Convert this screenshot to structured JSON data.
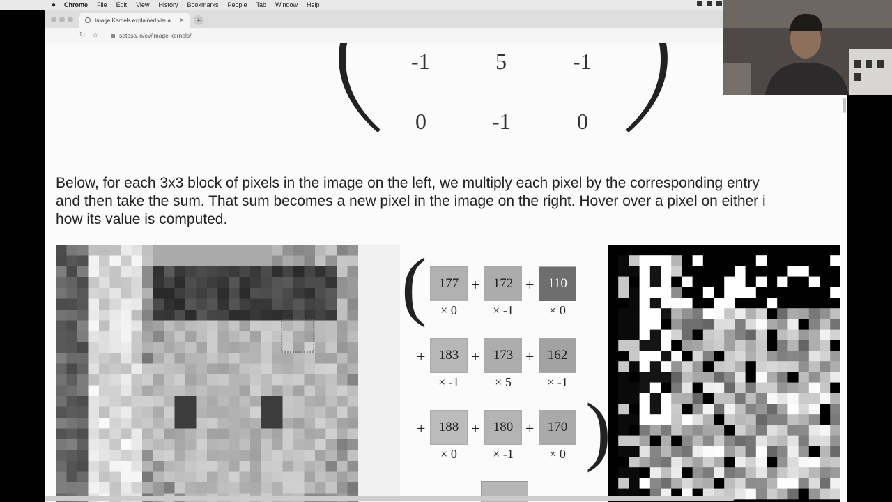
{
  "menubar": {
    "app": "Chrome",
    "items": [
      "File",
      "Edit",
      "View",
      "History",
      "Bookmarks",
      "People",
      "Tab",
      "Window",
      "Help"
    ]
  },
  "browser": {
    "tab_title": "Image Kernels explained visua",
    "new_tab": "+",
    "tab_close": "×",
    "url": "setosa.io/ev/image-kernels/"
  },
  "kernel_matrix": {
    "row2": [
      "-1",
      "5",
      "-1"
    ],
    "row3": [
      "0",
      "-1",
      "0"
    ]
  },
  "paragraph": {
    "line1": "Below, for each 3x3 block of pixels in the image on the left, we multiply each pixel by the corresponding entry",
    "line2": "and then take the sum. That sum becomes a new pixel in the image on the right. Hover over a pixel on either i",
    "line3": "how its value is computed."
  },
  "computation": {
    "rows": [
      {
        "cells": [
          {
            "value": "177",
            "mult": "× 0",
            "shade": "#b1b1b1"
          },
          {
            "value": "172",
            "mult": "× -1",
            "shade": "#acacac"
          },
          {
            "value": "110",
            "mult": "× 0",
            "shade": "#6e6e6e"
          }
        ]
      },
      {
        "cells": [
          {
            "value": "183",
            "mult": "× -1",
            "shade": "#b7b7b7"
          },
          {
            "value": "173",
            "mult": "× 5",
            "shade": "#adadad"
          },
          {
            "value": "162",
            "mult": "× -1",
            "shade": "#a2a2a2"
          }
        ]
      },
      {
        "cells": [
          {
            "value": "188",
            "mult": "× 0",
            "shade": "#bcbcbc"
          },
          {
            "value": "180",
            "mult": "× -1",
            "shade": "#b4b4b4"
          },
          {
            "value": "170",
            "mult": "× 0",
            "shade": "#aaaaaa"
          }
        ]
      }
    ],
    "plus": "+"
  },
  "colors": {
    "page_bg": "#fbfbfb",
    "chrome_bg": "#dedede",
    "right_image_bg": "#000000"
  }
}
